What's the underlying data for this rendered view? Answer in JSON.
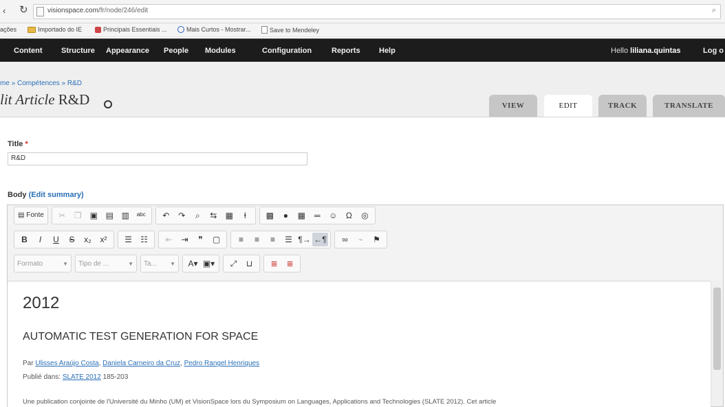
{
  "browser": {
    "url_host": "visionspace.com",
    "url_path": "/fr/node/246/edit",
    "bookmarks": [
      {
        "label": "ações"
      },
      {
        "label": "Importado do IE",
        "icon": "folder-icon"
      },
      {
        "label": "Principais Essentiais ...",
        "icon": "app-icon"
      },
      {
        "label": "Mais Curtos - Mostrar...",
        "icon": "globe-icon"
      },
      {
        "label": "Save to Mendeley",
        "icon": "page-icon"
      }
    ]
  },
  "toolbar": {
    "items": [
      "Content",
      "Structure",
      "Appearance",
      "People",
      "Modules",
      "Configuration",
      "Reports",
      "Help"
    ],
    "hello_prefix": "Hello",
    "username": "liliana.quintas",
    "logout": "Log o"
  },
  "header": {
    "breadcrumb": "me » Compétences » R&D",
    "title_italic": "lit Article",
    "title_plain": "R&D",
    "tabs": [
      {
        "label": "VIEW",
        "active": false
      },
      {
        "label": "EDIT",
        "active": true
      },
      {
        "label": "TRACK",
        "active": false
      },
      {
        "label": "TRANSLATE",
        "active": false
      }
    ]
  },
  "form": {
    "title_label": "Title",
    "required_mark": "*",
    "title_value": "R&D",
    "body_label": "Body",
    "edit_summary": "(Edit summary)"
  },
  "editor": {
    "source_label": "Fonte",
    "dropdowns": {
      "format": "Formato",
      "style": "Tipo de ...",
      "size": "Ta..."
    }
  },
  "content": {
    "year": "2012",
    "heading": "AUTOMATIC TEST GENERATION FOR SPACE",
    "by_prefix": "Par",
    "authors": [
      "Ulisses Araújo Costa",
      "Daniela Carneiro da Cruz",
      "Pedro Rangel Henriques"
    ],
    "published_prefix": "Publié dans:",
    "venue": "SLATE 2012",
    "pages": "185-203",
    "body": "Une publication conjointe de l'Université du Minho (UM) et VisionSpace lors du Symposium on Languages, Applications and Technologies (SLATE 2012). Cet article"
  }
}
